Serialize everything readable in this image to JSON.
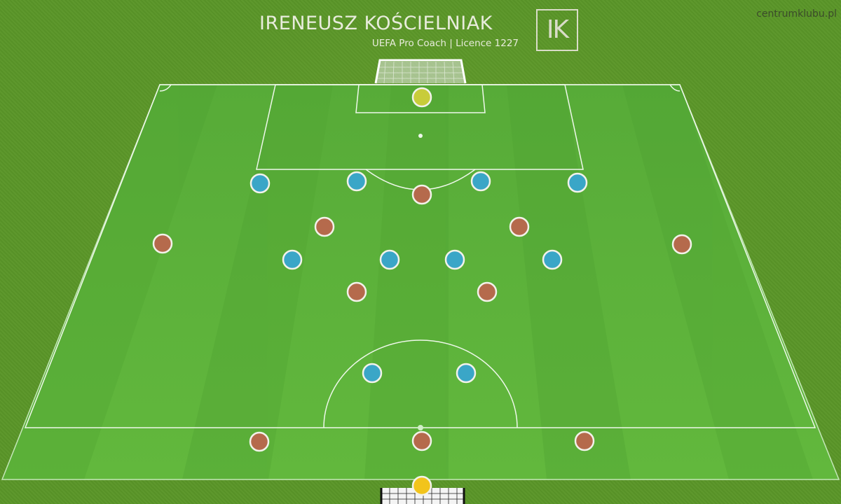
{
  "header": {
    "coach_name": "IRENEUSZ KOŚCIELNIAK",
    "coach_subtitle": "UEFA Pro Coach   |   Licence 1227",
    "logo_text": "IK",
    "watermark": "centrumklubu.pl"
  },
  "colors": {
    "grass_dark": "#5a9628",
    "pitch_light": "#5fb33c",
    "pitch_stripe": "#54a635",
    "line": "#e6f5e0",
    "team_blue": "#3aa6c7",
    "team_brown": "#b56a4c",
    "goalkeeper_top": "#c8cc3a",
    "goalkeeper_bottom": "#f2c41c",
    "player_outline": "#f2f2ea"
  },
  "players": [
    {
      "team": "goalkeeper-top"
    },
    {
      "team": "blue"
    },
    {
      "team": "blue"
    },
    {
      "team": "blue"
    },
    {
      "team": "blue"
    },
    {
      "team": "brown"
    },
    {
      "team": "brown"
    },
    {
      "team": "brown"
    },
    {
      "team": "brown"
    },
    {
      "team": "brown"
    },
    {
      "team": "blue"
    },
    {
      "team": "blue"
    },
    {
      "team": "blue"
    },
    {
      "team": "blue"
    },
    {
      "team": "brown"
    },
    {
      "team": "brown"
    },
    {
      "team": "blue"
    },
    {
      "team": "blue"
    },
    {
      "team": "brown"
    },
    {
      "team": "brown"
    },
    {
      "team": "brown"
    },
    {
      "team": "goalkeeper-bottom"
    }
  ]
}
